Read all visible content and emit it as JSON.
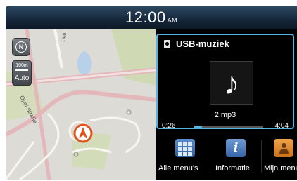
{
  "status_bar": {
    "time": "12:00",
    "ampm": "AM"
  },
  "map": {
    "compass_label": "N",
    "scale_distance": "100m",
    "zoom_mode": "Auto",
    "street_labels": [
      "Opel-Straße",
      "Lieb"
    ]
  },
  "media": {
    "source_title": "USB-muziek",
    "file_name": "2.mp3",
    "elapsed": "0:26",
    "duration": "4:04",
    "progress": 0.11,
    "note_symbol": "♪"
  },
  "menu": {
    "items": [
      {
        "label": "Alle menu's",
        "icon": "grid-icon"
      },
      {
        "label": "Informatie",
        "icon": "info-icon"
      },
      {
        "label": "Mijn menu",
        "icon": "user-icon"
      }
    ]
  },
  "colors": {
    "accent": "#56b4e2",
    "vehicle_marker": "#e2541e",
    "road": "#f7f3ee",
    "green": "#cbd9a8"
  }
}
